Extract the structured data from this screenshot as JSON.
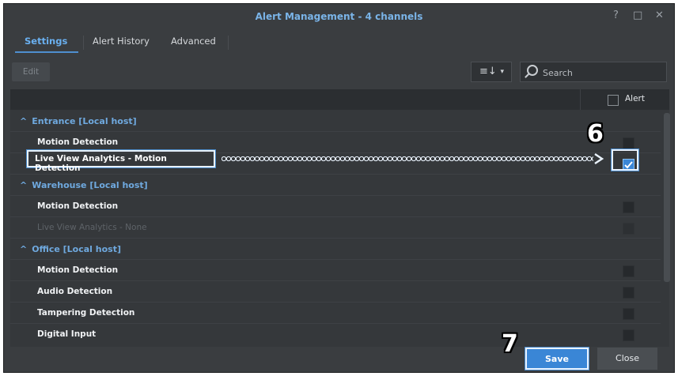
{
  "window": {
    "title": "Alert Management - 4 channels",
    "help_glyph": "?",
    "maximize_glyph": "□",
    "close_glyph": "✕"
  },
  "tabs": [
    {
      "label": "Settings",
      "active": true
    },
    {
      "label": "Alert History",
      "active": false
    },
    {
      "label": "Advanced",
      "active": false
    }
  ],
  "toolbar": {
    "edit_label": "Edit",
    "sort_glyph": "≡↓",
    "sort_caret": "▾",
    "search_placeholder": "Search"
  },
  "grid": {
    "alert_header": "Alert",
    "groups": [
      {
        "name": "Entrance [Local host]",
        "items": [
          {
            "label": "Motion Detection",
            "checked": false,
            "dim": false
          },
          {
            "label": "Live View Analytics - Motion Detection",
            "checked": true,
            "dim": false
          }
        ]
      },
      {
        "name": "Warehouse [Local host]",
        "items": [
          {
            "label": "Motion Detection",
            "checked": false,
            "dim": false
          },
          {
            "label": "Live View Analytics - None",
            "checked": false,
            "dim": true
          }
        ]
      },
      {
        "name": "Office [Local host]",
        "items": [
          {
            "label": "Motion Detection",
            "checked": false,
            "dim": false
          },
          {
            "label": "Audio Detection",
            "checked": false,
            "dim": false
          },
          {
            "label": "Tampering Detection",
            "checked": false,
            "dim": false
          },
          {
            "label": "Digital Input",
            "checked": false,
            "dim": false
          }
        ]
      }
    ]
  },
  "annotations": {
    "step6": "6",
    "step7": "7"
  },
  "footer": {
    "save_label": "Save",
    "close_label": "Close"
  },
  "colors": {
    "accent": "#3a86d6",
    "group_text": "#6fa9df",
    "window_bg": "#3a3d40"
  }
}
